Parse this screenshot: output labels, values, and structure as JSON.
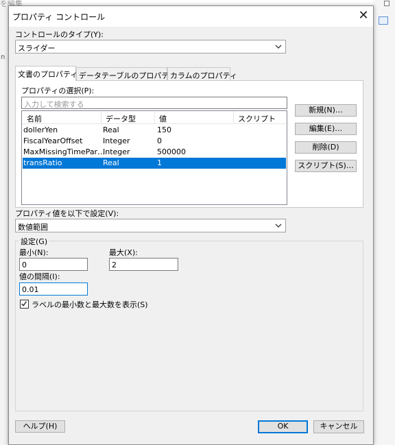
{
  "background": {
    "title_fragment": "を編集",
    "left_text": "n"
  },
  "dialog": {
    "title": "プロパティ コントロール",
    "close_glyph": "✕"
  },
  "control_type": {
    "label": "コントロールのタイプ(Y):",
    "value": "スライダー"
  },
  "tabs": [
    {
      "label": "文書のプロパティ",
      "active": true
    },
    {
      "label": "データテーブルのプロパティ",
      "active": false
    },
    {
      "label": "カラムのプロパティ",
      "active": false
    }
  ],
  "property_select": {
    "label": "プロパティの選択(P):",
    "search_placeholder": "入力して検索する"
  },
  "table": {
    "columns": [
      "名前",
      "データ型",
      "値",
      "スクリプト"
    ],
    "rows": [
      {
        "name": "dollerYen",
        "type": "Real",
        "value": "150",
        "script": "",
        "selected": false
      },
      {
        "name": "FiscalYearOffset",
        "type": "Integer",
        "value": "0",
        "script": "",
        "selected": false
      },
      {
        "name": "MaxMissingTimePar…",
        "type": "Integer",
        "value": "500000",
        "script": "",
        "selected": false
      },
      {
        "name": "transRatio",
        "type": "Real",
        "value": "1",
        "script": "",
        "selected": true
      }
    ]
  },
  "side_buttons": {
    "new": "新規(N)…",
    "edit": "編集(E)…",
    "delete": "削除(D)",
    "script": "スクリプト(S)…"
  },
  "value_source": {
    "label": "プロパティ値を以下で設定(V):",
    "value": "数値範囲"
  },
  "settings": {
    "group_label": "設定(G)",
    "min_label": "最小(N):",
    "min_value": "0",
    "max_label": "最大(X):",
    "max_value": "2",
    "step_label": "値の間隔(I):",
    "step_value": "0.01",
    "show_minmax_label": "ラベルの最小数と最大数を表示(S)",
    "show_minmax_checked": true
  },
  "footer": {
    "help": "ヘルプ(H)",
    "ok": "OK",
    "cancel": "キャンセル"
  },
  "colors": {
    "selection": "#0078d7",
    "dialog_bg": "#f0f0f0"
  }
}
